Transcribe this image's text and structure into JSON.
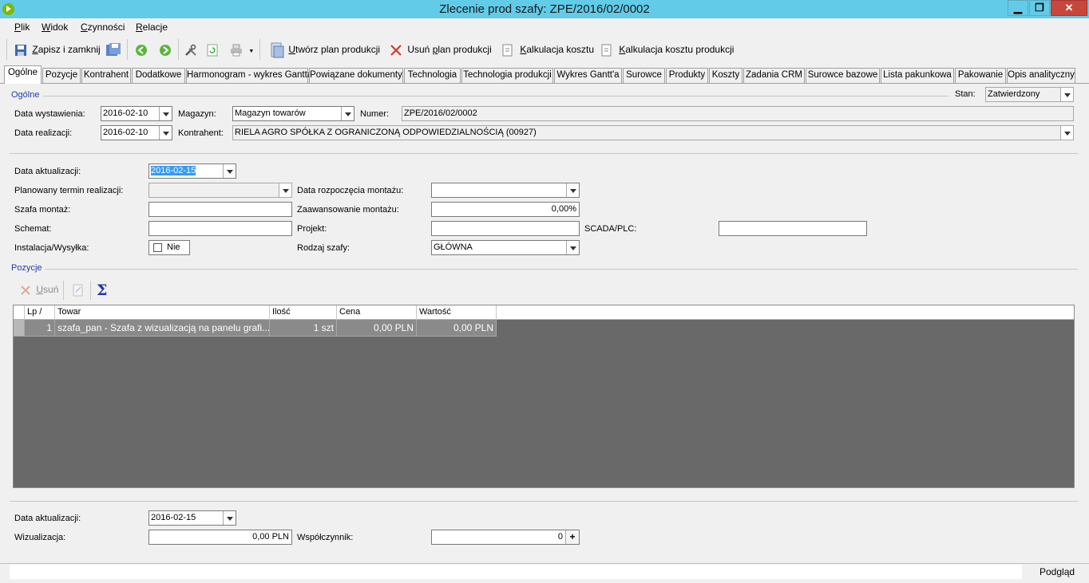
{
  "window": {
    "title": "Zlecenie prod szafy: ZPE/2016/02/0002",
    "minimize": "▁",
    "maximize": "❐",
    "close": "✕"
  },
  "menu": [
    {
      "key": "P",
      "rest": "lik"
    },
    {
      "key": "W",
      "rest": "idok"
    },
    {
      "key": "C",
      "rest": "zynności"
    },
    {
      "key": "R",
      "rest": "elacje"
    }
  ],
  "toolbar": {
    "save_close_key": "Z",
    "save_close_rest": "apisz i zamknij",
    "create_plan_key": "U",
    "create_plan_rest": "twórz plan produkcji",
    "delete_plan_pre": "Usuń ",
    "delete_plan_key": "p",
    "delete_plan_rest": "lan produkcji",
    "cost_calc_key": "K",
    "cost_calc_rest": "alkulacja kosztu",
    "cost_calc_prod_key": "K",
    "cost_calc_prod_rest": "alkulacja kosztu produkcji"
  },
  "tabs": [
    "Ogólne",
    "Pozycje",
    "Kontrahent",
    "Dodatkowe",
    "Harmonogram - wykres Gantta",
    "Powiązane dokumenty",
    "Technologia",
    "Technologia produkcji",
    "Wykres Gantt'a",
    "Surowce",
    "Produkty",
    "Koszty",
    "Zadania CRM",
    "Surowce bazowe",
    "Lista pakunkowa",
    "Pakowanie",
    "Opis analityczny"
  ],
  "general": {
    "group_label": "Ogólne",
    "status_label": "Stan:",
    "status_value": "Zatwierdzony",
    "issue_date_label": "Data wystawienia:",
    "issue_date": "2016-02-10",
    "warehouse_label": "Magazyn:",
    "warehouse": "Magazyn towarów",
    "number_label": "Numer:",
    "number": "ZPE/2016/02/0002",
    "realization_date_label": "Data realizacji:",
    "realization_date": "2016-02-10",
    "contractor_label": "Kontrahent:",
    "contractor": "RIELA AGRO SPÓŁKA Z OGRANICZONĄ ODPOWIEDZIALNOŚCIĄ (00927)"
  },
  "details": {
    "update_date_label": "Data aktualizacji:",
    "update_date": "2016-02-15",
    "planned_term_label": "Planowany termin realizacji:",
    "planned_term": "",
    "assembly_start_label": "Data rozpoczęcia montażu:",
    "assembly_start": "",
    "cabinet_assembly_label": "Szafa montaż:",
    "cabinet_assembly": "",
    "assembly_progress_label": "Zaawansowanie montażu:",
    "assembly_progress": "0,00%",
    "scheme_label": "Schemat:",
    "scheme": "",
    "project_label": "Projekt:",
    "project": "",
    "scada_label": "SCADA/PLC:",
    "scada": "",
    "install_label": "Instalacja/Wysyłka:",
    "install_value": "Nie",
    "cabinet_type_label": "Rodzaj szafy:",
    "cabinet_type": "GŁÓWNA"
  },
  "positions": {
    "group_label": "Pozycje",
    "delete_key": "U",
    "delete_rest": "suń",
    "columns": [
      "Lp /",
      "Towar",
      "Ilość",
      "Cena",
      "Wartość"
    ],
    "rows": [
      {
        "lp": "1",
        "item": "szafa_pan - Szafa z wizualizacją na panelu grafi...",
        "qty": "1 szt",
        "price": "0,00 PLN",
        "value": "0,00 PLN"
      }
    ]
  },
  "footer": {
    "update_date_label": "Data aktualizacji:",
    "update_date": "2016-02-15",
    "visualization_label": "Wizualizacja:",
    "visualization": "0,00 PLN",
    "coefficient_label": "Współczynnik:",
    "coefficient": "0"
  },
  "statusbar": {
    "preview": "Podgląd"
  },
  "colors": {
    "titlebar": "#62cbe8",
    "group_label": "#1f3aa7",
    "grid_bg": "#696969",
    "close": "#c6473b"
  }
}
